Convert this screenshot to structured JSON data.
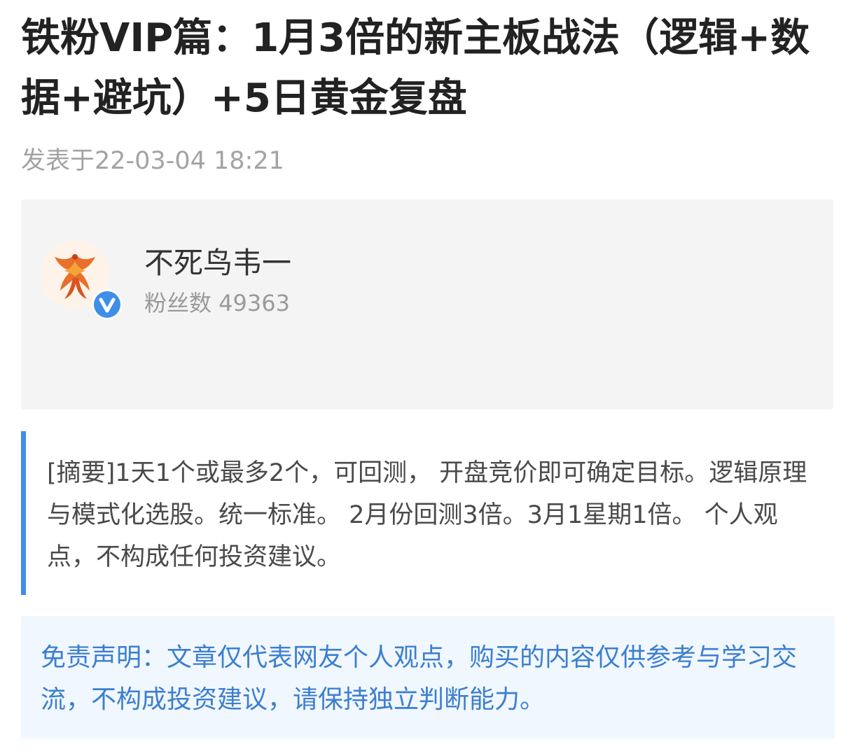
{
  "article": {
    "title": "铁粉VIP篇：1月3倍的新主板战法（逻辑+数据+避坑）+5日黄金复盘",
    "post_time": "发表于22-03-04 18:21"
  },
  "author": {
    "name": "不死鸟韦一",
    "fans": "粉丝数 49363",
    "avatar_icon": "phoenix-avatar",
    "badge_icon": "verified-v-icon",
    "badge_color": "#3f8ee8"
  },
  "summary": {
    "text": "[摘要]1天1个或最多2个，可回测， 开盘竞价即可确定目标。逻辑原理与模式化选股。统一标准。 2月份回测3倍。3月1星期1倍。 个人观点，不构成任何投资建议。",
    "accent_color": "#3f8ee8"
  },
  "disclaimer": {
    "text": "免责声明：文章仅代表网友个人观点，购买的内容仅供参考与学习交流，不构成投资建议，请保持独立判断能力。",
    "text_color": "#3b7fcf",
    "background": "#f1f7fe"
  }
}
